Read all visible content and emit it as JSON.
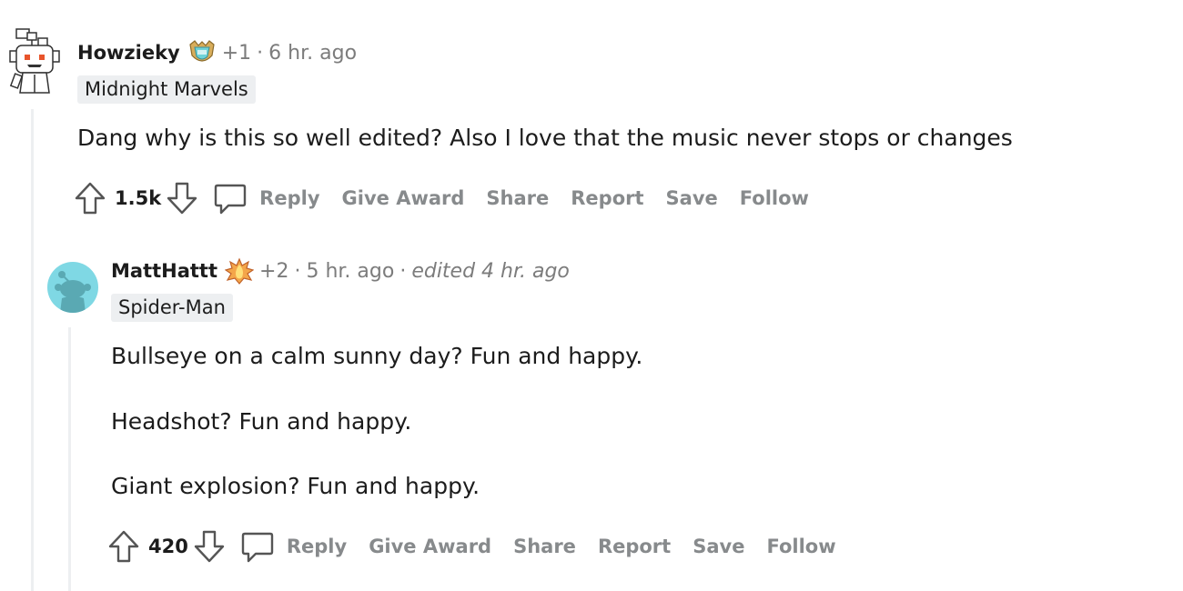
{
  "comments": [
    {
      "username": "Howzieky",
      "badge_icon": "award-badge-icon",
      "karma": "+1",
      "separator": "·",
      "time": "6 hr. ago",
      "edited": "",
      "flair": "Midnight Marvels",
      "body": [
        "Dang why is this so well edited? Also I love that the music never stops or changes"
      ],
      "score": "1.5k",
      "actions": [
        "Reply",
        "Give Award",
        "Share",
        "Report",
        "Save",
        "Follow"
      ]
    },
    {
      "username": "MattHattt",
      "badge_icon": "fire-award-icon",
      "karma": "+2",
      "separator": "·",
      "time": "5 hr. ago",
      "edited": "edited 4 hr. ago",
      "flair": "Spider-Man",
      "body": [
        "Bullseye on a calm sunny day? Fun and happy.",
        "Headshot? Fun and happy.",
        "Giant explosion? Fun and happy."
      ],
      "score": "420",
      "actions": [
        "Reply",
        "Give Award",
        "Share",
        "Report",
        "Save",
        "Follow"
      ]
    }
  ],
  "colors": {
    "thread_line": "#edeff1",
    "meta_gray": "#7c7c7c",
    "action_gray": "#878a8c",
    "avatar_teal": "#7fd8e4"
  }
}
